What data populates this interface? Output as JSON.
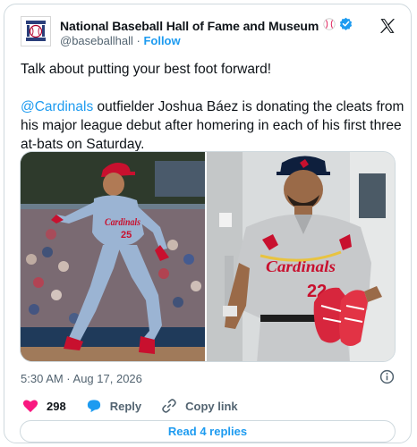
{
  "account": {
    "name": "National Baseball Hall of Fame and Museum",
    "handle": "@baseballhall",
    "separator": "·",
    "follow_label": "Follow"
  },
  "tweet": {
    "line1": "Talk about putting your best foot forward!",
    "mention": "@Cardinals",
    "line2_rest": " outfielder Joshua Báez is donating the cleats from his major league debut after homering in each of his first three at-bats on Saturday.",
    "timestamp": "5:30 AM · Aug 17, 2026"
  },
  "jersey": {
    "wordmark": "Cardinals",
    "number_left": "25",
    "number_right": "22"
  },
  "actions": {
    "like_count": "298",
    "reply_label": "Reply",
    "copy_link_label": "Copy link"
  },
  "read_replies_label": "Read 4 replies",
  "colors": {
    "link_blue": "#1d9bf0",
    "like_red": "#f91880",
    "text": "#0f1419",
    "muted": "#536471",
    "border": "#cfd9de"
  },
  "icons": [
    "hof-logo-icon",
    "baseball-emoji-icon",
    "verified-badge-icon",
    "x-logo-icon",
    "info-icon",
    "heart-icon",
    "reply-bubble-icon",
    "link-icon"
  ]
}
